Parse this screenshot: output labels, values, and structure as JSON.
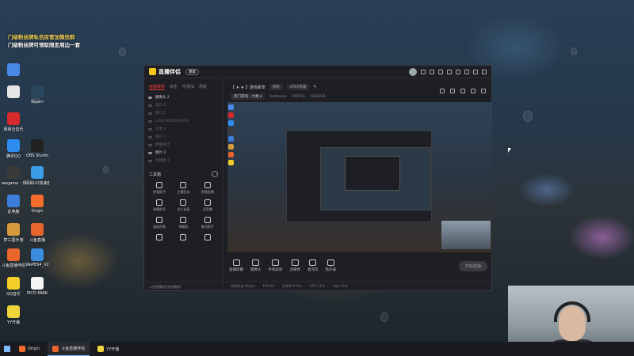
{
  "desktop": {
    "promo_lines": [
      "门级粉丝牌私信房管加微信群",
      "门级粉丝牌可领取限定周边一套"
    ],
    "icons": [
      {
        "label": "",
        "color": "#4a8ae6"
      },
      {
        "label": "",
        "color": "#e6e6e6"
      },
      {
        "label": "网易云音乐",
        "color": "#d6292b"
      },
      {
        "label": "腾讯QQ",
        "color": "#2d8cf0"
      },
      {
        "label": "wegame - 快捷方式",
        "color": "#3a3a3a"
      },
      {
        "label": "此电脑",
        "color": "#3b7dd8"
      },
      {
        "label": "梦三国手游",
        "color": "#d59a3b"
      },
      {
        "label": "斗鱼直播伴侣",
        "color": "#e8652b"
      },
      {
        "label": "QQ音乐",
        "color": "#f4cf2a"
      },
      {
        "label": "YY开播",
        "color": "#f0d53a"
      },
      {
        "label": "Steam",
        "color": "#2a475e"
      },
      {
        "label": "OBS Studio",
        "color": "#222222"
      },
      {
        "label": "网易UU加速器",
        "color": "#3c9de6"
      },
      {
        "label": "Origin",
        "color": "#f56c2d"
      },
      {
        "label": "斗鱼直播",
        "color": "#e8652b"
      },
      {
        "label": "WePE64_V2",
        "color": "#3c8de0"
      },
      {
        "label": "PICO PARK",
        "color": "#f5f5f5"
      }
    ]
  },
  "app": {
    "title": "直播伴侣",
    "version": "测试",
    "tabs": [
      "画面模板",
      "双击",
      "可添加",
      "场景"
    ],
    "sources": [
      {
        "name": "摄像头 2",
        "on": true
      },
      {
        "name": "窗口 1",
        "on": false
      },
      {
        "name": "窗口 1",
        "on": false
      },
      {
        "name": "LOVESICKWHISPER",
        "on": false
      },
      {
        "name": "文本 1",
        "on": false
      },
      {
        "name": "图片 1",
        "on": false
      },
      {
        "name": "数据统计",
        "on": false
      },
      {
        "name": "图片 2",
        "on": true
      },
      {
        "name": "视频源 1",
        "on": false
      }
    ],
    "tools_title": "工具箱",
    "tools": [
      "房管助手",
      "主播任务",
      "视频直播",
      "弹幕助手",
      "点人连麦",
      "语音播",
      "虚拟形象",
      "弹幕机",
      "歌词助手",
      "",
      "",
      ""
    ],
    "left_footer": "斗鱼直播伴侣使用教程",
    "header": {
      "game_label": "【 ★ ★ 】游戏新宠",
      "edit": "修改",
      "category": "APEX英雄",
      "line2_chip": "热门游戏 - 大乘 ▾",
      "line2_a": "Instances",
      "line2_b": "709710",
      "line2_c": "1036221"
    },
    "controls": [
      "直播屏幕",
      "摄像头",
      "手机投屏",
      "多媒体",
      "麦克风",
      "扬声器"
    ],
    "start_label": "开始直播",
    "status": [
      "网络状态 0kbps",
      "FPS:60",
      "丢帧率 0.0%",
      "CPU 11%",
      "内存 55%"
    ]
  },
  "taskbar": {
    "items": [
      {
        "label": "Origin",
        "color": "#f56c2d",
        "active": false
      },
      {
        "label": "斗鱼直播伴侣",
        "color": "#e8652b",
        "active": true
      },
      {
        "label": "YY开播",
        "color": "#f0d53a",
        "active": false
      }
    ]
  }
}
